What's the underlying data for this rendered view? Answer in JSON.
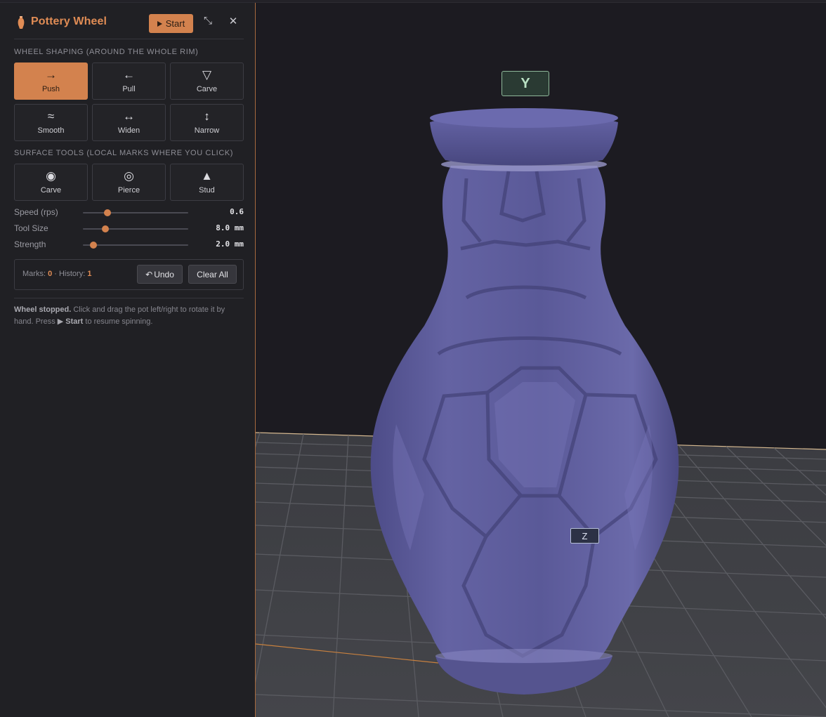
{
  "app": {
    "title": "Pottery Wheel",
    "icon": "vase-icon",
    "accent_color": "#d3824e"
  },
  "header": {
    "start_label": "Start",
    "expand_icon": "expand-icon",
    "close_icon": "close-icon"
  },
  "wheel_shaping": {
    "label": "WHEEL SHAPING (AROUND THE WHOLE RIM)",
    "tools": [
      {
        "label": "Push",
        "glyph": "→",
        "active": true
      },
      {
        "label": "Pull",
        "glyph": "←",
        "active": false
      },
      {
        "label": "Carve",
        "glyph": "▽",
        "active": false
      },
      {
        "label": "Smooth",
        "glyph": "≈",
        "active": false
      },
      {
        "label": "Widen",
        "glyph": "↔",
        "active": false
      },
      {
        "label": "Narrow",
        "glyph": "↕",
        "active": false
      }
    ]
  },
  "surface_tools": {
    "label": "SURFACE TOOLS (LOCAL MARKS WHERE YOU CLICK)",
    "tools": [
      {
        "label": "Carve",
        "glyph": "◉"
      },
      {
        "label": "Pierce",
        "glyph": "◎"
      },
      {
        "label": "Stud",
        "glyph": "▲"
      }
    ]
  },
  "sliders": [
    {
      "label": "Speed (rps)",
      "value": "0.6",
      "fraction": 0.23
    },
    {
      "label": "Tool Size",
      "value": "8.0 mm",
      "fraction": 0.21
    },
    {
      "label": "Strength",
      "value": "2.0 mm",
      "fraction": 0.1
    }
  ],
  "status": {
    "marks_label": "Marks:",
    "marks_value": "0",
    "history_label": "· History:",
    "history_value": "1",
    "undo_label": "Undo",
    "clear_label": "Clear All"
  },
  "help": {
    "bold": "Wheel stopped.",
    "text1": " Click and drag the pot left/right to rotate it by hand. Press ",
    "start_ref": "Start",
    "text2": " to resume spinning."
  },
  "viewport": {
    "axis_y_label": "Y",
    "axis_z_label": "Z",
    "pot_color": "#5f5e9c"
  }
}
